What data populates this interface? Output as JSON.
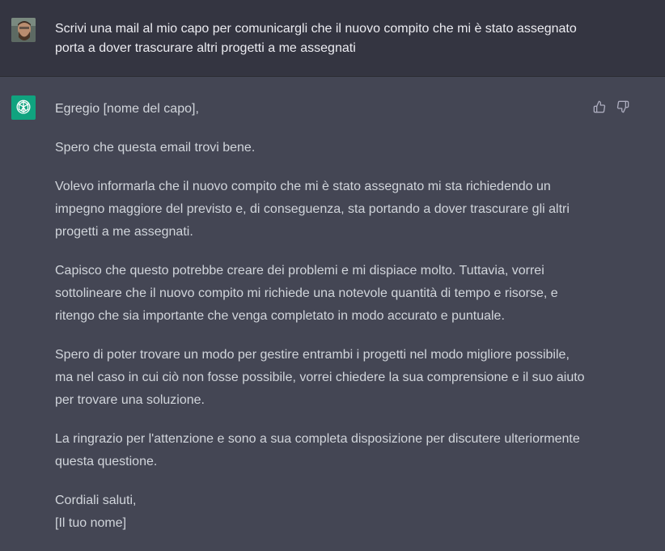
{
  "user_message": {
    "lines": [
      "Scrivi una mail al mio capo per comunicargli che il nuovo compito che mi è stato assegnato",
      "porta a dover trascurare altri progetti a me assegnati"
    ]
  },
  "assistant_message": {
    "paragraphs": [
      [
        "Egregio [nome del capo],"
      ],
      [
        "Spero che questa email trovi bene."
      ],
      [
        "Volevo informarla che il nuovo compito che mi è stato assegnato mi sta richiedendo un",
        "impegno maggiore del previsto e, di conseguenza, sta portando a dover trascurare gli altri",
        "progetti a me assegnati."
      ],
      [
        "Capisco che questo potrebbe creare dei problemi e mi dispiace molto. Tuttavia, vorrei",
        "sottolineare che il nuovo compito mi richiede una notevole quantità di tempo e risorse, e",
        "ritengo che sia importante che venga completato in modo accurato e puntuale."
      ],
      [
        "Spero di poter trovare un modo per gestire entrambi i progetti nel modo migliore possibile,",
        "ma nel caso in cui ciò non fosse possibile, vorrei chiedere la sua comprensione e il suo aiuto",
        "per trovare una soluzione."
      ],
      [
        "La ringrazio per l'attenzione e sono a sua completa disposizione per discutere ulteriormente",
        "questa questione."
      ],
      [
        "Cordiali saluti,",
        "[Il tuo nome]"
      ]
    ]
  },
  "icons": {
    "user_avatar": "user-avatar",
    "bot_avatar": "openai-logo-icon",
    "thumbs_up": "thumbs-up-icon",
    "thumbs_down": "thumbs-down-icon"
  },
  "colors": {
    "user_bg": "#343541",
    "assistant_bg": "#444654",
    "bot_avatar_bg": "#10a37f",
    "text": "#d1d5db"
  }
}
